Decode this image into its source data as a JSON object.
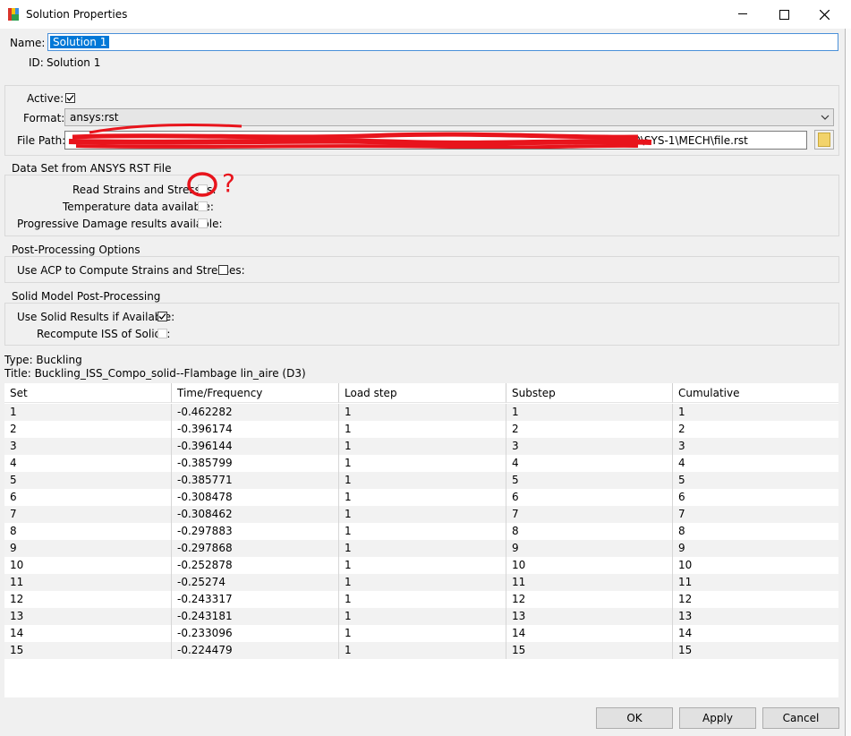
{
  "window": {
    "title": "Solution Properties"
  },
  "fields": {
    "name_label": "Name:",
    "name_value": "Solution 1",
    "id_label": "ID:",
    "id_value": "Solution 1"
  },
  "top_group": {
    "active_label": "Active:",
    "active_checked": true,
    "format_label": "Format:",
    "format_value": "ansys:rst",
    "filepath_label": "File Path:",
    "filepath_visible": "dp0\\SYS-1\\MECH\\file.rst"
  },
  "data_set_group": {
    "title": "Data Set from ANSYS RST File",
    "read_strains_label": "Read Strains and Stresses:",
    "temperature_label": "Temperature data available:",
    "progressive_damage_label": "Progressive Damage results available:",
    "annotation_mark": "?"
  },
  "postproc_group": {
    "title": "Post-Processing Options",
    "use_acp_label": "Use ACP to Compute Strains and Stresses:"
  },
  "solid_group": {
    "title": "Solid Model Post-Processing",
    "use_solid_label": "Use Solid Results if Available:",
    "use_solid_checked": true,
    "recompute_label": "Recompute ISS of Solids:"
  },
  "info": {
    "type_line": "Type: Buckling",
    "title_line": "Title: Buckling_ISS_Compo_solid--Flambage lin_aire (D3)"
  },
  "table": {
    "columns": [
      "Set",
      "Time/Frequency",
      "Load step",
      "Substep",
      "Cumulative"
    ],
    "rows": [
      [
        "1",
        "-0.462282",
        "1",
        "1",
        "1"
      ],
      [
        "2",
        "-0.396174",
        "1",
        "2",
        "2"
      ],
      [
        "3",
        "-0.396144",
        "1",
        "3",
        "3"
      ],
      [
        "4",
        "-0.385799",
        "1",
        "4",
        "4"
      ],
      [
        "5",
        "-0.385771",
        "1",
        "5",
        "5"
      ],
      [
        "6",
        "-0.308478",
        "1",
        "6",
        "6"
      ],
      [
        "7",
        "-0.308462",
        "1",
        "7",
        "7"
      ],
      [
        "8",
        "-0.297883",
        "1",
        "8",
        "8"
      ],
      [
        "9",
        "-0.297868",
        "1",
        "9",
        "9"
      ],
      [
        "10",
        "-0.252878",
        "1",
        "10",
        "10"
      ],
      [
        "11",
        "-0.25274",
        "1",
        "11",
        "11"
      ],
      [
        "12",
        "-0.243317",
        "1",
        "12",
        "12"
      ],
      [
        "13",
        "-0.243181",
        "1",
        "13",
        "13"
      ],
      [
        "14",
        "-0.233096",
        "1",
        "14",
        "14"
      ],
      [
        "15",
        "-0.224479",
        "1",
        "15",
        "15"
      ]
    ]
  },
  "buttons": {
    "ok": "OK",
    "apply": "Apply",
    "cancel": "Cancel"
  },
  "colors": {
    "selection": "#0078d7",
    "annotation": "#e8141c",
    "folder": "#f2d36b"
  }
}
